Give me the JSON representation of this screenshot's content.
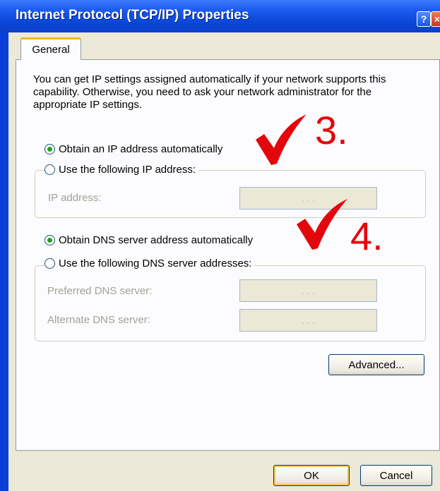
{
  "window": {
    "title": "Internet Protocol (TCP/IP) Properties",
    "help_label": "?",
    "close_label": "×"
  },
  "tabs": [
    {
      "label": "General",
      "selected": true
    }
  ],
  "general": {
    "description": "You can get IP settings assigned automatically if your network supports this capability. Otherwise, you need to ask your network administrator for the appropriate IP settings.",
    "ip_auto_label": "Obtain an IP address automatically",
    "ip_auto_selected": true,
    "ip_manual_label": "Use the following IP address:",
    "ip_manual_selected": false,
    "ip_address_label": "IP address:",
    "ip_address_value": ".   .   .",
    "dns_auto_label": "Obtain DNS server address automatically",
    "dns_auto_selected": true,
    "dns_manual_label": "Use the following DNS server addresses:",
    "dns_manual_selected": false,
    "preferred_dns_label": "Preferred DNS server:",
    "preferred_dns_value": ".   .   .",
    "alternate_dns_label": "Alternate DNS server:",
    "alternate_dns_value": ".   .   .",
    "advanced_label": "Advanced..."
  },
  "footer": {
    "ok_label": "OK",
    "cancel_label": "Cancel"
  },
  "annotations": {
    "step3": "3.",
    "step4": "4.",
    "color": "#e3070d"
  },
  "colors": {
    "titlebar": "#0a46d8",
    "dialog_bg": "#ece9d8",
    "radio_dot": "#21a121"
  }
}
